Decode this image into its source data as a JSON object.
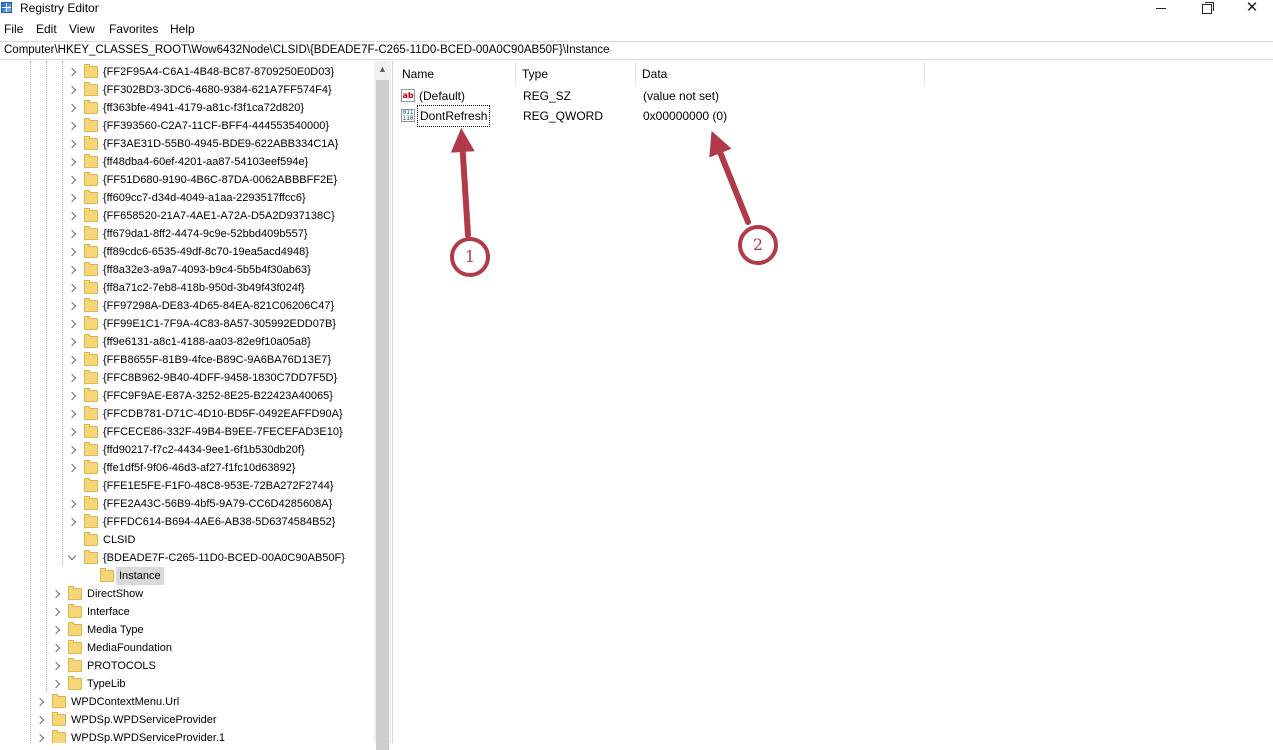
{
  "window": {
    "title": "Registry Editor"
  },
  "menu": [
    "File",
    "Edit",
    "View",
    "Favorites",
    "Help"
  ],
  "address": "Computer\\HKEY_CLASSES_ROOT\\Wow6432Node\\CLSID\\{BDEADE7F-C265-11D0-BCED-00A0C90AB50F}\\Instance",
  "tree": {
    "clsid_children": [
      "{FF2F95A4-C6A1-4B48-BC87-8709250E0D03}",
      "{FF302BD3-3DC6-4680-9384-621A7FF574F4}",
      "{ff363bfe-4941-4179-a81c-f3f1ca72d820}",
      "{FF393560-C2A7-11CF-BFF4-444553540000}",
      "{FF3AE31D-55B0-4945-BDE9-622ABB334C1A}",
      "{ff48dba4-60ef-4201-aa87-54103eef594e}",
      "{FF51D680-9190-4B6C-87DA-0062ABBBFF2E}",
      "{ff609cc7-d34d-4049-a1aa-2293517ffcc6}",
      "{FF658520-21A7-4AE1-A72A-D5A2D937138C}",
      "{ff679da1-8ff2-4474-9c9e-52bbd409b557}",
      "{ff89cdc6-6535-49df-8c70-19ea5acd4948}",
      "{ff8a32e3-a9a7-4093-b9c4-5b5b4f30ab63}",
      "{ff8a71c2-7eb8-418b-950d-3b49f43f024f}",
      "{FF97298A-DE83-4D65-84EA-821C06206C47}",
      "{FF99E1C1-7F9A-4C83-8A57-305992EDD07B}",
      "{ff9e6131-a8c1-4188-aa03-82e9f10a05a8}",
      "{FFB8655F-81B9-4fce-B89C-9A6BA76D13E7}",
      "{FFC8B962-9B40-4DFF-9458-1830C7DD7F5D}",
      "{FFC9F9AE-E87A-3252-8E25-B22423A40065}",
      "{FFCDB781-D71C-4D10-BD5F-0492EAFFD90A}",
      "{FFCECE86-332F-49B4-B9EE-7FECEFAD3E10}",
      "{ffd90217-f7c2-4434-9ee1-6f1b530db20f}",
      "{ffe1df5f-9f06-46d3-af27-f1fc10d63892}",
      "{FFE1E5FE-F1F0-48C8-953E-72BA272F2744}",
      "{FFE2A43C-56B9-4bf5-9A79-CC6D4285608A}",
      "{FFFDC614-B694-4AE6-AB38-5D6374584B52}",
      "CLSID",
      "{BDEADE7F-C265-11D0-BCED-00A0C90AB50F}"
    ],
    "instance": "Instance",
    "wow_siblings": [
      "DirectShow",
      "Interface",
      "Media Type",
      "MediaFoundation",
      "PROTOCOLS",
      "TypeLib"
    ],
    "hkcr_siblings": [
      "WPDContextMenu.Url",
      "WPDSp.WPDServiceProvider",
      "WPDSp.WPDServiceProvider.1"
    ]
  },
  "columns": {
    "name": "Name",
    "type": "Type",
    "data": "Data"
  },
  "values": [
    {
      "icon": "string-value-icon",
      "glyph": "ab",
      "name": "(Default)",
      "type": "REG_SZ",
      "data": "(value not set)"
    },
    {
      "icon": "binary-value-icon",
      "glyph": "011\n110",
      "name": "DontRefresh",
      "type": "REG_QWORD",
      "data": "0x00000000 (0)"
    }
  ],
  "annotations": [
    {
      "label": "1",
      "color": "#b03a48"
    },
    {
      "label": "2",
      "color": "#b03a48"
    }
  ]
}
